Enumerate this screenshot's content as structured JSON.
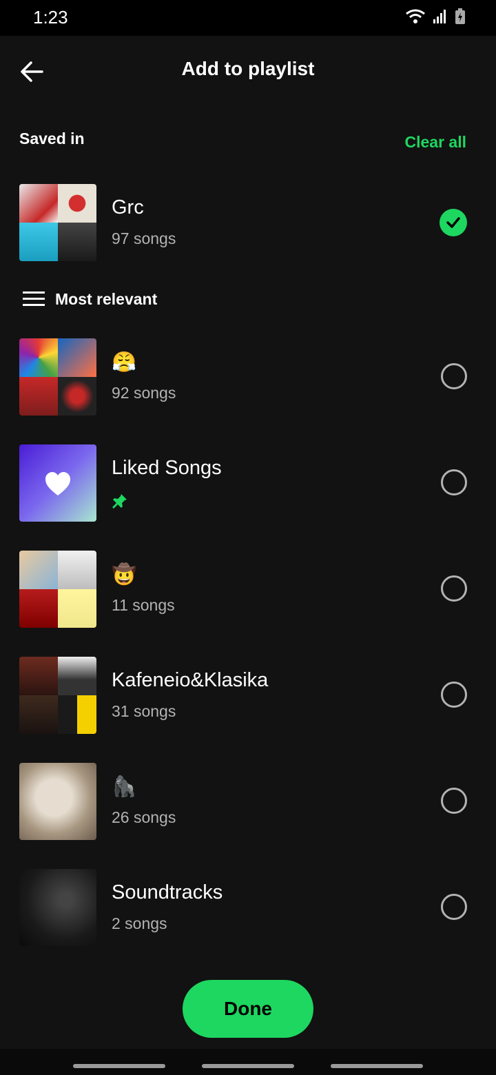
{
  "status": {
    "time": "1:23"
  },
  "header": {
    "title": "Add to playlist"
  },
  "saved": {
    "label": "Saved in",
    "clear_label": "Clear all"
  },
  "saved_playlist": {
    "name": "Grc",
    "sub": "97 songs",
    "selected": true
  },
  "sort": {
    "label": "Most relevant"
  },
  "playlists": [
    {
      "name": "😤",
      "sub": "92 songs",
      "selected": false
    },
    {
      "name": "Liked Songs",
      "sub": "",
      "pinned": true,
      "selected": false
    },
    {
      "name": "🤠",
      "sub": "11 songs",
      "selected": false
    },
    {
      "name": "Kafeneio&Klasika",
      "sub": "31 songs",
      "selected": false
    },
    {
      "name": "🦍",
      "sub": "26 songs",
      "selected": false
    },
    {
      "name": "Soundtracks",
      "sub": "2 songs",
      "selected": false
    }
  ],
  "done_label": "Done",
  "colors": {
    "accent": "#1ed760",
    "background": "#121212",
    "secondary_text": "#b3b3b3"
  }
}
